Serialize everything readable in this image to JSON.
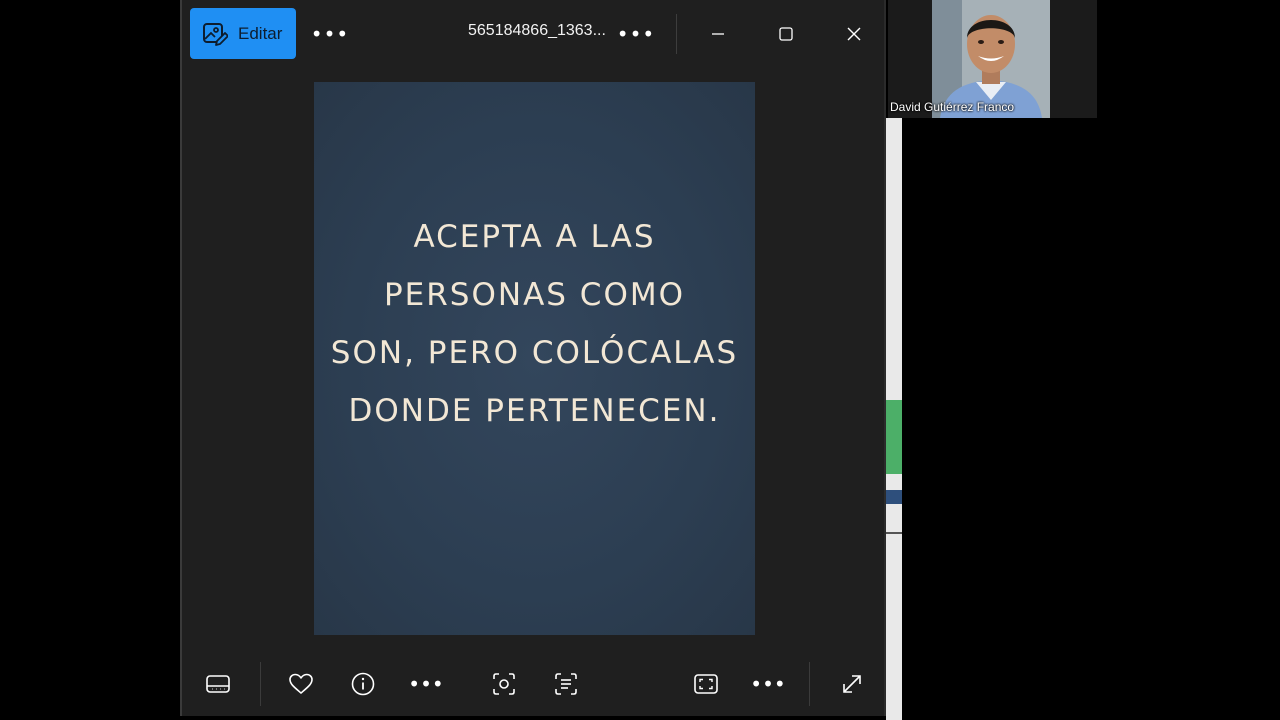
{
  "viewer": {
    "edit_label": "Editar",
    "more_options_label": "•••",
    "filename": "565184866_1363...",
    "file_more_label": "•••",
    "photo_quote_lines": [
      "ACEPTA A LAS",
      "PERSONAS COMO",
      "SON, PERO COLÓCALAS",
      "DONDE PERTENECEN."
    ],
    "toolbar": {
      "more_label": "•••",
      "view_more_label": "•••"
    }
  },
  "meeting": {
    "participant_name": "David Gutiérrez Franco"
  },
  "icons": {
    "edit": "edit-image-icon",
    "minimize": "minimize-icon",
    "maximize": "maximize-icon",
    "close": "close-icon",
    "filmstrip": "filmstrip-icon",
    "favorite": "heart-icon",
    "info": "info-icon",
    "visual_search": "visual-search-icon",
    "text_scan": "scan-text-icon",
    "fit": "fit-to-window-icon",
    "fullscreen": "fullscreen-icon"
  },
  "colors": {
    "accent": "#1f8ff3",
    "window_bg": "#1f1f1f",
    "photo_bg": "#2c3e52",
    "quote_text": "#f2e7d5"
  }
}
